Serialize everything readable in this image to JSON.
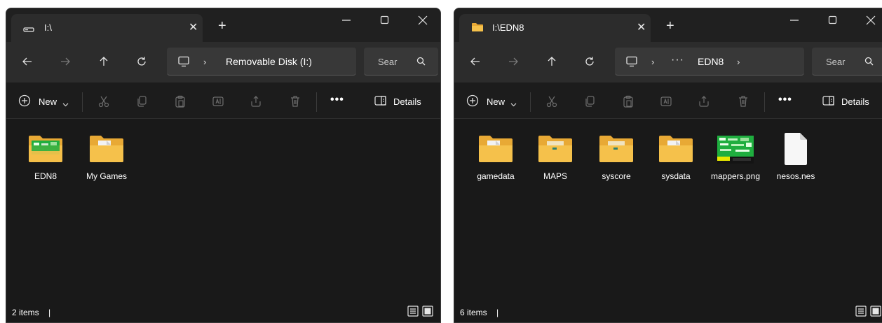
{
  "windows": [
    {
      "tab_title": "I:\\",
      "tab_icon": "drive-icon",
      "address": {
        "parts": [
          "Removable Disk (I:)"
        ],
        "show_ellipsis": false
      },
      "search_placeholder": "Sear",
      "commands": {
        "new_label": "New",
        "details_label": "Details",
        "more_label": "•••"
      },
      "items": [
        {
          "label": "EDN8",
          "icon": "folder-thumbnail-green"
        },
        {
          "label": "My Games",
          "icon": "folder-with-document"
        }
      ],
      "status": "2 items"
    },
    {
      "tab_title": "I:\\EDN8",
      "tab_icon": "folder-icon",
      "address": {
        "parts": [
          "EDN8"
        ],
        "show_ellipsis": true,
        "ellipsis": "···"
      },
      "search_placeholder": "Sear",
      "commands": {
        "new_label": "New",
        "details_label": "Details",
        "more_label": "•••"
      },
      "items": [
        {
          "label": "gamedata",
          "icon": "folder-with-document"
        },
        {
          "label": "MAPS",
          "icon": "folder-with-chip"
        },
        {
          "label": "syscore",
          "icon": "folder-with-chip"
        },
        {
          "label": "sysdata",
          "icon": "folder-with-document"
        },
        {
          "label": "mappers.png",
          "icon": "image-thumbnail"
        },
        {
          "label": "nesos.nes",
          "icon": "blank-file"
        }
      ],
      "status": "6 items"
    }
  ],
  "colors": {
    "window_bg": "#191919",
    "titlebar_bg": "#202020",
    "tab_bg": "#2c2c2c",
    "field_bg": "#383838",
    "folder_yellow": "#f5c14b",
    "folder_back": "#e8a935",
    "thumb_green": "#1fae3f"
  }
}
